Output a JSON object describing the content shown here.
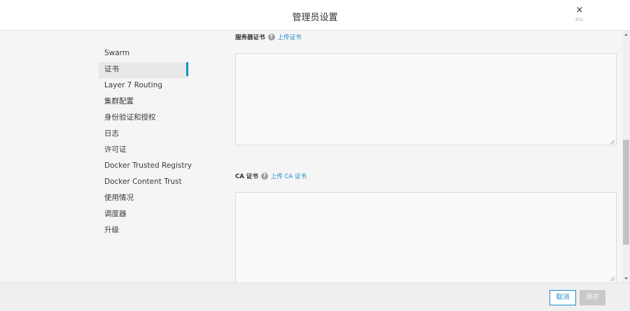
{
  "header": {
    "title": "管理员设置",
    "close_glyph": "×",
    "close_hint": "Esc"
  },
  "sidebar": {
    "items": [
      {
        "label": "Swarm"
      },
      {
        "label": "证书",
        "active": true
      },
      {
        "label": "Layer 7 Routing"
      },
      {
        "label": "集群配置"
      },
      {
        "label": "身份验证和授权"
      },
      {
        "label": "日志"
      },
      {
        "label": "许可证"
      },
      {
        "label": "Docker Trusted Registry"
      },
      {
        "label": "Docker Content Trust"
      },
      {
        "label": "使用情况"
      },
      {
        "label": "调度器"
      },
      {
        "label": "升级"
      }
    ]
  },
  "sections": {
    "server_cert": {
      "label": "服务器证书",
      "help_glyph": "?",
      "link": "上传证书",
      "value": ""
    },
    "ca_cert": {
      "label": "CA 证书",
      "help_glyph": "?",
      "link": "上传 CA 证书",
      "value": ""
    }
  },
  "footer": {
    "cancel_label": "取消",
    "save_label": "保存"
  },
  "colors": {
    "accent": "#1b8dc8",
    "active_item_bg": "#e8e8e8",
    "disabled_button": "#c9c9c9"
  },
  "icons": [
    "close-icon",
    "help-icon",
    "resize-grip-icon",
    "scroll-up-arrow-icon",
    "scroll-down-arrow-icon"
  ]
}
